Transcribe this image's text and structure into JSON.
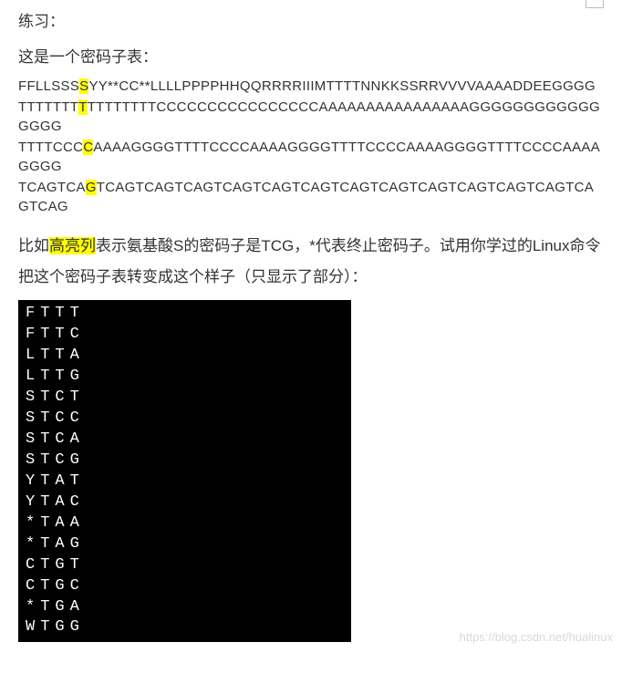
{
  "title": "练习：",
  "intro": "这是一个密码子表：",
  "codon_lines": [
    {
      "pre": "FFLLSSS",
      "hl": "S",
      "post": "YY**CC**LLLLPPPPHHQQRRRRIIIMTTTTNNKKSSRRVVVVAAAADDEEGGGG"
    },
    {
      "pre": "TTTTTTT",
      "hl": "T",
      "post": "TTTTTTTTCCCCCCCCCCCCCCCCAAAAAAAAAAAAAAAAGGGGGGGGGGGGGGGG"
    },
    {
      "pre": "TTTTCCC",
      "hl": "C",
      "post": "AAAAGGGGTTTTCCCCAAAAGGGGTTTTCCCCAAAAGGGGTTTTCCCCAAAAGGGG"
    },
    {
      "pre": "TCAGTCA",
      "hl": "G",
      "post": "TCAGTCAGTCAGTCAGTCAGTCAGTCAGTCAGTCAGTCAGTCAGTCAGTCAGTCAG"
    }
  ],
  "explain_pre": "比如",
  "explain_hl": "高亮列",
  "explain_post": "表示氨基酸S的密码子是TCG，*代表终止密码子。试用你学过的Linux命令把这个密码子表转变成这个样子（只显示了部分）：",
  "terminal_rows": [
    "FTTT",
    "FTTC",
    "LTTA",
    "LTTG",
    "STCT",
    "STCC",
    "STCA",
    "STCG",
    "YTAT",
    "YTAC",
    "*TAA",
    "*TAG",
    "CTGT",
    "CTGC",
    "*TGA",
    "WTGG"
  ],
  "watermark": "https://blog.csdn.net/hualinux"
}
